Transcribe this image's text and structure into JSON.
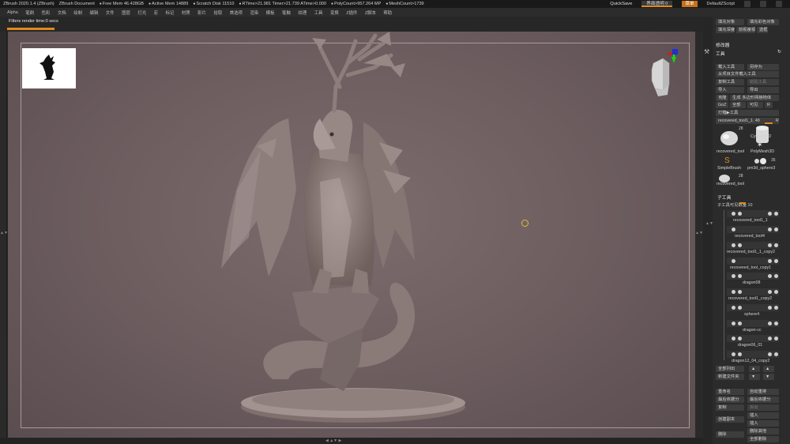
{
  "titlebar": {
    "app": "ZBrush 2020.1.4 (ZBrush)",
    "document": "ZBrush Document",
    "free_mem": "Free Mem 46.428GB",
    "active_mem": "Active Mem 14889",
    "scratch": "Scratch Disk 11510",
    "rtime": "RTime>21.981 Timer>21.739 ATime>0.000",
    "polycount": "PolyCount>957.264 MP",
    "meshcount": "MeshCount>1739",
    "quicksave": "QuickSave",
    "transparency": "界面透明 0",
    "menu": "菜单",
    "script": "DefaultZScript"
  },
  "menubar": [
    "Alpha",
    "笔刷",
    "色彩",
    "文档",
    "绘制",
    "编辑",
    "文件",
    "图层",
    "灯光",
    "宏",
    "标记",
    "材质",
    "影片",
    "拾取",
    "首选项",
    "渲染",
    "模板",
    "笔触",
    "纹理",
    "工具",
    "变换",
    "Z插件",
    "Z脚本",
    "帮助"
  ],
  "status": {
    "render_time": "Filters render time:0 secs",
    "progress": 1.0
  },
  "palette": {
    "top_buttons": [
      "填充对象",
      "填充彩色对象",
      "填充深度",
      "前视度视角",
      "选框"
    ],
    "modifier_header": "修改器",
    "tool_header": "工具",
    "tool_buttons": [
      {
        "label": "载入工具",
        "dim": false
      },
      {
        "label": "另存为",
        "dim": false
      },
      {
        "label": "从项目文件载入工具",
        "dim": false
      },
      {
        "label": "复制工具",
        "dim": false
      },
      {
        "label": "粘贴工具",
        "dim": true
      },
      {
        "label": "导入",
        "dim": false
      },
      {
        "label": "导出",
        "dim": false
      },
      {
        "label": "克隆",
        "dim": false
      },
      {
        "label": "生成 多边形网格物体",
        "dim": false
      },
      {
        "label": "GoZ",
        "dim": false
      },
      {
        "label": "全部",
        "dim": false
      },
      {
        "label": "可见",
        "dim": false
      },
      {
        "label": "R",
        "dim": false
      },
      {
        "label": "灯箱▶工具",
        "dim": false
      }
    ],
    "tool_slider": {
      "label": "recovered_tool1_1. 49",
      "value": "R"
    },
    "tool_thumbs": [
      {
        "label": "recovered_tool",
        "count": "28"
      },
      {
        "label": "Cylinder3D",
        "count": ""
      },
      {
        "label": "PolyMesh3D",
        "count": ""
      },
      {
        "label": "SimpleBrush",
        "count": ""
      },
      {
        "label": "pm3d_sphere3",
        "count": "35"
      },
      {
        "label": "recovered_tool",
        "count": "28"
      }
    ],
    "subtool_header": "子工具",
    "subtool_slider": {
      "label": "子工具可见数量 10",
      "value": 10
    },
    "subtools": [
      "recovered_tool1_1",
      "recovered_tool4",
      "recovered_tool1_1_copy2",
      "recovered_tool_copy1",
      "dragon08",
      "recovered_tool1_copy2",
      "sphere4",
      "dragon-cc",
      "dragon06_01",
      "dragon12_04_copy2"
    ],
    "list_buttons": [
      "全部列出",
      "新建文件夹"
    ],
    "bottom_buttons": [
      {
        "label": "重命名",
        "dim": false
      },
      {
        "label": "自动重排",
        "dim": false
      },
      {
        "label": "最后依据分",
        "dim": false
      },
      {
        "label": "最后依据分",
        "dim": false
      },
      {
        "label": "复制",
        "dim": false
      },
      {
        "label": "拆出",
        "dim": true
      },
      {
        "label": "创建副本",
        "dim": false
      },
      {
        "label": "插入",
        "dim": false
      },
      {
        "label": "插入",
        "dim": false
      },
      {
        "label": "删除",
        "dim": false
      },
      {
        "label": "删除其他",
        "dim": false
      },
      {
        "label": "全部删除",
        "dim": false
      }
    ]
  },
  "colors": {
    "accent": "#e08a1e",
    "canvas": "#6f5f61",
    "model": "#8e7e7c"
  }
}
